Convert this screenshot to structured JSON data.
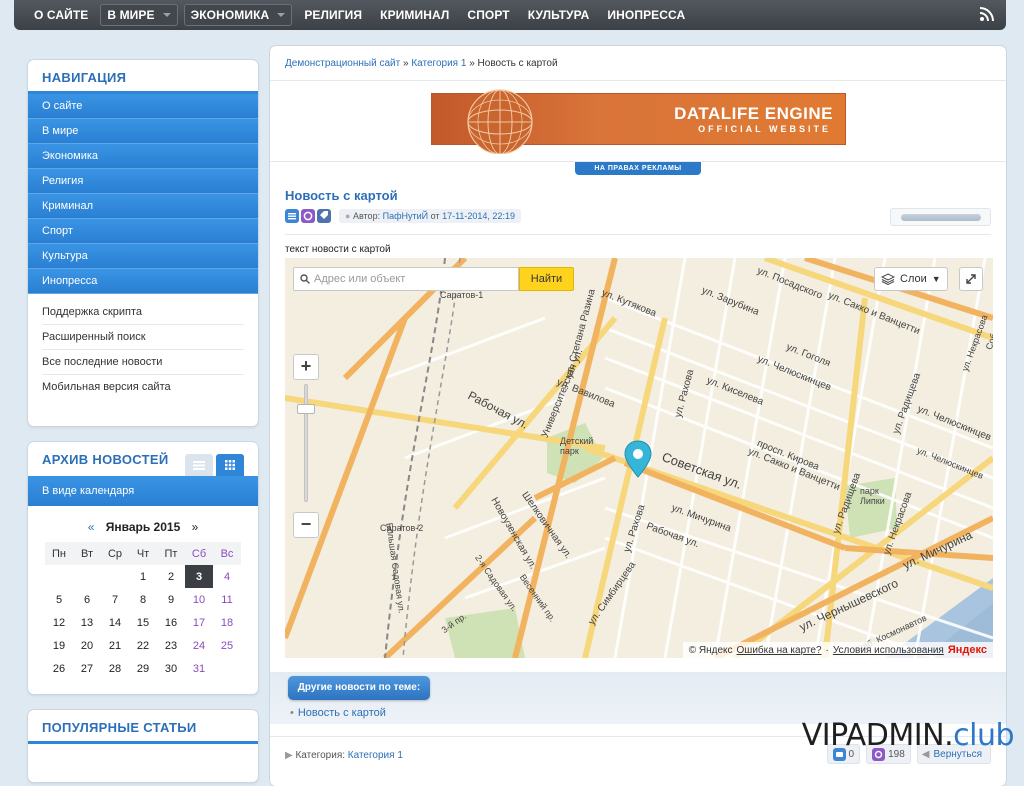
{
  "topnav": {
    "items": [
      "О САЙТЕ",
      "В МИРЕ",
      "ЭКОНОМИКА",
      "РЕЛИГИЯ",
      "КРИМИНАЛ",
      "СПОРТ",
      "КУЛЬТУРА",
      "ИНОПРЕССА"
    ],
    "rss_icon": "rss-icon"
  },
  "sidebar": {
    "nav_title": "НАВИГАЦИЯ",
    "nav_items": [
      "О сайте",
      "В мире",
      "Экономика",
      "Религия",
      "Криминал",
      "Спорт",
      "Культура",
      "Инопресса"
    ],
    "extra_items": [
      "Поддержка скрипта",
      "Расширенный поиск",
      "Все последние новости",
      "Мобильная версия сайта"
    ],
    "archive_title": "АРХИВ НОВОСТЕЙ",
    "archive_mode": "В виде календаря",
    "calendar": {
      "prev": "«",
      "next": "»",
      "month": "Январь 2015",
      "weekdays": [
        "Пн",
        "Вт",
        "Ср",
        "Чт",
        "Пт",
        "Сб",
        "Вс"
      ],
      "weeks": [
        [
          "",
          "",
          "",
          "1",
          "2",
          "3",
          "4"
        ],
        [
          "5",
          "6",
          "7",
          "8",
          "9",
          "10",
          "11"
        ],
        [
          "12",
          "13",
          "14",
          "15",
          "16",
          "17",
          "18"
        ],
        [
          "19",
          "20",
          "21",
          "22",
          "23",
          "24",
          "25"
        ],
        [
          "26",
          "27",
          "28",
          "29",
          "30",
          "31",
          ""
        ]
      ],
      "today": "3"
    },
    "popular_title": "ПОПУЛЯРНЫЕ СТАТЬИ"
  },
  "breadcrumb": {
    "home": "Демонстрационный сайт",
    "sep": "»",
    "category": "Категория 1",
    "current": "Новость с картой"
  },
  "banner": {
    "line1": "DATALIFE ENGINE",
    "line2": "OFFICIAL WEBSITE",
    "ad_label": "НА ПРАВАХ РЕКЛАМЫ"
  },
  "article": {
    "title": "Новость с картой",
    "author_prefix": "Автор:",
    "author": "ПафНутиЙ",
    "date_prefix": "от",
    "date": "17-11-2014, 22:19",
    "text": "текст новости с картой"
  },
  "map": {
    "search_placeholder": "Адрес или объект",
    "find_button": "Найти",
    "layers_button": "Слои",
    "zoom_in": "+",
    "zoom_out": "−",
    "labels": {
      "posadskogo": "ул. Посадского",
      "kutyakova": "ул. Кутякова",
      "zarubina": "ул. Зарубина",
      "sakko1": "ул. Сакко и Ванцетти",
      "gogolya": "ул. Гоголя",
      "chelyuskintsev1": "ул. Челюскинцев",
      "kiseleva": "ул. Киселева",
      "radishcheva1": "ул. Радищева",
      "vavilova": "ул. Вавилова",
      "rabochaya1": "Рабочая ул.",
      "universitetskaya": "Университетская ул.",
      "stepana": "ул. Степана Разина",
      "rakhova1": "ул. Рахова",
      "detsky_park": "Детский парк",
      "kirova": "просп. Кирова",
      "sakko2": "ул. Сакко и Ванцетти",
      "sovetskaya": "Советская ул.",
      "radishcheva2": "ул. Радищева",
      "nekrasova": "ул. Некрасова",
      "chelyuskintsev2": "ул. Челюскинцев",
      "park_lipki": "парк Липки",
      "michurina1": "ул. Мичурина",
      "michurina2": "ул. Мичурина",
      "rakhova2": "ул. Рахова",
      "rabochaya2": "Рабочая ул.",
      "shelkovichnaya": "Шелковичная ул.",
      "novouzenskaya": "Новоузенская ул.",
      "sadovaya2": "2-я Садовая ул.",
      "vesennyaya": "Весенний пр.",
      "simbirtseva": "ул. Симбирцева",
      "chernyshevskogo": "ул. Чернышевского",
      "kosmonavtov": "наб. Космонавтов",
      "saratov1": "Саратов-1",
      "saratov2": "Саратов-2",
      "bolshaya_sadovaya": "Большая Садовая ул.",
      "rabochaya_sm": "3-й пр.",
      "chelyuskintsev3": "ул. Челюскинцев",
      "nekrasova2": "ул. Некрасова",
      "sobornaya": "Соборная ул."
    },
    "copyright_prefix": "© Яндекс",
    "report_error": "Ошибка на карте?",
    "terms": "Условия использования",
    "brand": "Яндекс"
  },
  "related": {
    "button": "Другие новости по теме:",
    "items": [
      "Новость с картой"
    ]
  },
  "footer": {
    "category_label": "Категория:",
    "category": "Категория 1",
    "comments": "0",
    "views": "198",
    "back": "Вернуться"
  },
  "watermark": {
    "main": "VIPADMIN.",
    "suffix": "club"
  }
}
